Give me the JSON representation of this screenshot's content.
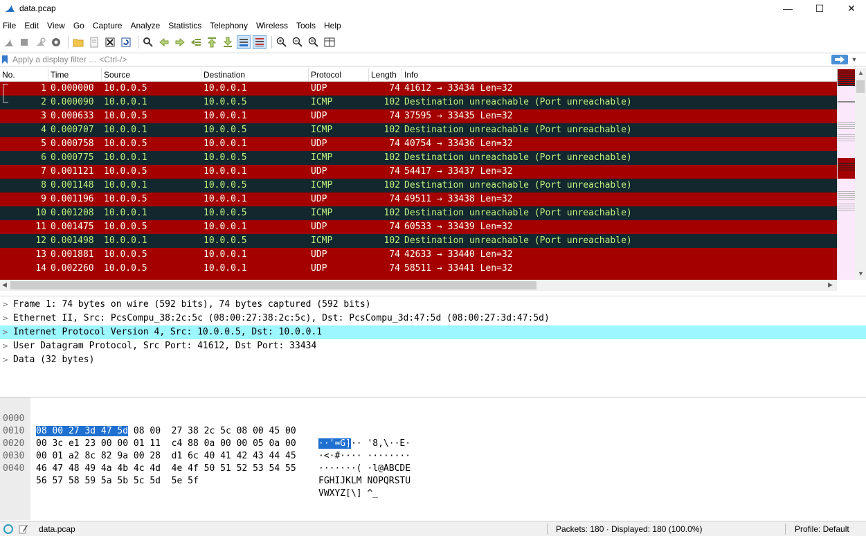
{
  "window": {
    "title": "data.pcap",
    "minimize": "—",
    "maximize": "☐",
    "close": "✕"
  },
  "menu": [
    "File",
    "Edit",
    "View",
    "Go",
    "Capture",
    "Analyze",
    "Statistics",
    "Telephony",
    "Wireless",
    "Tools",
    "Help"
  ],
  "filter": {
    "placeholder": "Apply a display filter … <Ctrl-/>"
  },
  "columns": [
    "No.",
    "Time",
    "Source",
    "Destination",
    "Protocol",
    "Length",
    "Info"
  ],
  "packets": [
    {
      "no": "1",
      "time": "0.000000",
      "src": "10.0.0.5",
      "dst": "10.0.0.1",
      "proto": "UDP",
      "len": "74",
      "info": "41612 → 33434 Len=32"
    },
    {
      "no": "2",
      "time": "0.000090",
      "src": "10.0.0.1",
      "dst": "10.0.0.5",
      "proto": "ICMP",
      "len": "102",
      "info": "Destination unreachable (Port unreachable)"
    },
    {
      "no": "3",
      "time": "0.000633",
      "src": "10.0.0.5",
      "dst": "10.0.0.1",
      "proto": "UDP",
      "len": "74",
      "info": "37595 → 33435 Len=32"
    },
    {
      "no": "4",
      "time": "0.000707",
      "src": "10.0.0.1",
      "dst": "10.0.0.5",
      "proto": "ICMP",
      "len": "102",
      "info": "Destination unreachable (Port unreachable)"
    },
    {
      "no": "5",
      "time": "0.000758",
      "src": "10.0.0.5",
      "dst": "10.0.0.1",
      "proto": "UDP",
      "len": "74",
      "info": "40754 → 33436 Len=32"
    },
    {
      "no": "6",
      "time": "0.000775",
      "src": "10.0.0.1",
      "dst": "10.0.0.5",
      "proto": "ICMP",
      "len": "102",
      "info": "Destination unreachable (Port unreachable)"
    },
    {
      "no": "7",
      "time": "0.001121",
      "src": "10.0.0.5",
      "dst": "10.0.0.1",
      "proto": "UDP",
      "len": "74",
      "info": "54417 → 33437 Len=32"
    },
    {
      "no": "8",
      "time": "0.001148",
      "src": "10.0.0.1",
      "dst": "10.0.0.5",
      "proto": "ICMP",
      "len": "102",
      "info": "Destination unreachable (Port unreachable)"
    },
    {
      "no": "9",
      "time": "0.001196",
      "src": "10.0.0.5",
      "dst": "10.0.0.1",
      "proto": "UDP",
      "len": "74",
      "info": "49511 → 33438 Len=32"
    },
    {
      "no": "10",
      "time": "0.001208",
      "src": "10.0.0.1",
      "dst": "10.0.0.5",
      "proto": "ICMP",
      "len": "102",
      "info": "Destination unreachable (Port unreachable)"
    },
    {
      "no": "11",
      "time": "0.001475",
      "src": "10.0.0.5",
      "dst": "10.0.0.1",
      "proto": "UDP",
      "len": "74",
      "info": "60533 → 33439 Len=32"
    },
    {
      "no": "12",
      "time": "0.001498",
      "src": "10.0.0.1",
      "dst": "10.0.0.5",
      "proto": "ICMP",
      "len": "102",
      "info": "Destination unreachable (Port unreachable)"
    },
    {
      "no": "13",
      "time": "0.001881",
      "src": "10.0.0.5",
      "dst": "10.0.0.1",
      "proto": "UDP",
      "len": "74",
      "info": "42633 → 33440 Len=32"
    },
    {
      "no": "14",
      "time": "0.002260",
      "src": "10.0.0.5",
      "dst": "10.0.0.1",
      "proto": "UDP",
      "len": "74",
      "info": "58511 → 33441 Len=32"
    }
  ],
  "details": [
    {
      "text": "Frame 1: 74 bytes on wire (592 bits), 74 bytes captured (592 bits)",
      "highlight": false
    },
    {
      "text": "Ethernet II, Src: PcsCompu_38:2c:5c (08:00:27:38:2c:5c), Dst: PcsCompu_3d:47:5d (08:00:27:3d:47:5d)",
      "highlight": false
    },
    {
      "text": "Internet Protocol Version 4, Src: 10.0.0.5, Dst: 10.0.0.1",
      "highlight": true
    },
    {
      "text": "User Datagram Protocol, Src Port: 41612, Dst Port: 33434",
      "highlight": false
    },
    {
      "text": "Data (32 bytes)",
      "highlight": false
    }
  ],
  "bytes": [
    {
      "offset": "0000",
      "hex_sel": "08 00 27 3d 47 5d",
      "hex": " 08 00  27 38 2c 5c 08 00 45 00",
      "ascii_sel": "··'=G]",
      "ascii": "·· '8,\\··E·"
    },
    {
      "offset": "0010",
      "hex_sel": "",
      "hex": "00 3c e1 23 00 00 01 11  c4 88 0a 00 00 05 0a 00",
      "ascii_sel": "",
      "ascii": "·<·#···· ········"
    },
    {
      "offset": "0020",
      "hex_sel": "",
      "hex": "00 01 a2 8c 82 9a 00 28  d1 6c 40 41 42 43 44 45",
      "ascii_sel": "",
      "ascii": "·······( ·l@ABCDE"
    },
    {
      "offset": "0030",
      "hex_sel": "",
      "hex": "46 47 48 49 4a 4b 4c 4d  4e 4f 50 51 52 53 54 55",
      "ascii_sel": "",
      "ascii": "FGHIJKLM NOPQRSTU"
    },
    {
      "offset": "0040",
      "hex_sel": "",
      "hex": "56 57 58 59 5a 5b 5c 5d  5e 5f",
      "ascii_sel": "",
      "ascii": "VWXYZ[\\] ^_"
    }
  ],
  "status": {
    "file": "data.pcap",
    "packets": "Packets: 180 · Displayed: 180 (100.0%)",
    "profile": "Profile: Default"
  },
  "colors": {
    "udp_bg": "#a40000",
    "udp_fg": "#fffcf4",
    "icmp_bg": "#12272e",
    "icmp_fg": "#c0f080",
    "detail_highlight": "#9cf7ff",
    "byte_select": "#1f70d1"
  }
}
